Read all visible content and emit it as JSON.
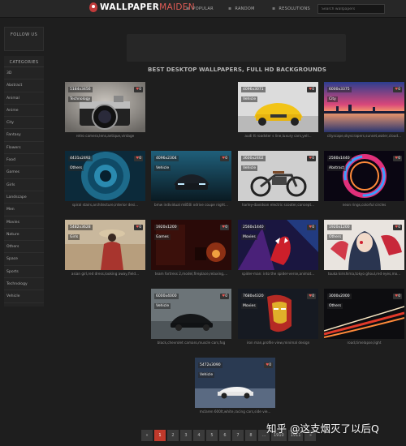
{
  "header": {
    "logo_primary": "WALLPAPER",
    "logo_secondary": "MAIDEN",
    "nav": [
      {
        "label": "POPULAR",
        "icon": "star-icon"
      },
      {
        "label": "RANDOM",
        "icon": "shuffle-icon"
      },
      {
        "label": "RESOLUTIONS",
        "icon": "screen-icon"
      }
    ],
    "search_placeholder": "Search wallpapers"
  },
  "sidebar": {
    "follow_title": "FOLLOW US",
    "categories_title": "CATEGORIES",
    "categories": [
      "3D",
      "Abstract",
      "Animal",
      "Anime",
      "City",
      "Fantasy",
      "Flowers",
      "Food",
      "Games",
      "Girls",
      "Landscape",
      "Men",
      "Movies",
      "Nature",
      "Others",
      "Space",
      "Sports",
      "Technology",
      "Vehicle"
    ]
  },
  "main": {
    "heading": "BEST DESKTOP WALLPAPERS, FULL HD BACKGROUNDS",
    "wallpapers": [
      {
        "resolution": "5184x3456",
        "category": "Technology",
        "count": "0",
        "caption": "retro camera,lens,antique,vintage"
      },
      {
        "resolution": "4096x3071",
        "category": "Vehicle",
        "count": "0",
        "caption": "audi tt roadster s line,luxury cars,yell..."
      },
      {
        "resolution": "6000x3375",
        "category": "City",
        "count": "0",
        "caption": "cityscape,skyscrapers,sunset,water,cloud..."
      },
      {
        "resolution": "4431x2492",
        "category": "Others",
        "count": "0",
        "caption": "spiral stairs,architecture,interior desi..."
      },
      {
        "resolution": "4096x2304",
        "category": "Vehicle",
        "count": "0",
        "caption": "bmw individual m850i xdrive coupe night..."
      },
      {
        "resolution": "3600x2402",
        "category": "Vehicle",
        "count": "0",
        "caption": "harley-davidson electric scooter,concept..."
      },
      {
        "resolution": "2560x1440",
        "category": "Abstract",
        "count": "0",
        "caption": "neon rings,colorful circles"
      },
      {
        "resolution": "5482x3628",
        "category": "Girls",
        "count": "0",
        "caption": "asian girl,red dress,looking away,field..."
      },
      {
        "resolution": "1920x1200",
        "category": "Games",
        "count": "0",
        "caption": "team fortress 2,model,fireplace,relaxing,..."
      },
      {
        "resolution": "2560x1440",
        "category": "Movies",
        "count": "0",
        "caption": "spider-man: into the spider-verse,animat..."
      },
      {
        "resolution": "1920x1200",
        "category": "Others",
        "count": "0",
        "caption": "touka kirishima,tokyo ghoul,red eyes,mo..."
      },
      {
        "resolution": "6000x4000",
        "category": "Vehicle",
        "count": "0",
        "caption": "black,chevrolet camaro,muscle cars,fog"
      },
      {
        "resolution": "7680x4320",
        "category": "Movies",
        "count": "0",
        "caption": "iron man,profile view,minimal design"
      },
      {
        "resolution": "3000x2000",
        "category": "Others",
        "count": "0",
        "caption": "road,timelapse,light"
      },
      {
        "resolution": "5472x3090",
        "category": "Vehicle",
        "count": "0",
        "caption": "mclaren 600lt,white,racing cars,side vie..."
      }
    ]
  },
  "pagination": {
    "prev": "«",
    "pages": [
      "1",
      "2",
      "3",
      "4",
      "5",
      "6",
      "7",
      "8"
    ],
    "ellipsis": "...",
    "tail": [
      "1910",
      "1911"
    ],
    "next": "»",
    "active": "1"
  },
  "watermark": "知乎 @这支烟灭了以后Q",
  "colors": {
    "accent": "#c0392b",
    "brand": "#e05b55"
  }
}
